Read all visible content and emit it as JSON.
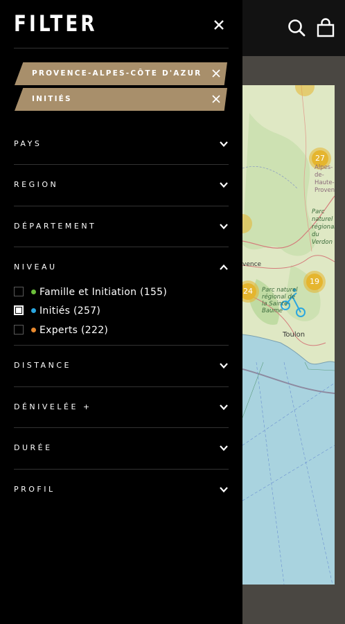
{
  "drawer": {
    "title": "FILTER",
    "active_tags": [
      {
        "label": "PROVENCE-ALPES-CÔTE D'AZUR"
      },
      {
        "label": "INITIÉS"
      }
    ],
    "sections": [
      {
        "label": "PAYS",
        "expanded": false
      },
      {
        "label": "REGION",
        "expanded": false
      },
      {
        "label": "DÉPARTEMENT",
        "expanded": false
      },
      {
        "label": "NIVEAU",
        "expanded": true
      },
      {
        "label": "DISTANCE",
        "expanded": false
      },
      {
        "label": "DÉNIVELÉE +",
        "expanded": false
      },
      {
        "label": "DURÉE",
        "expanded": false
      },
      {
        "label": "PROFIL",
        "expanded": false
      }
    ],
    "niveau_options": [
      {
        "label": "Famille et Initiation (155)",
        "checked": false,
        "dot_color": "#6bbf3a"
      },
      {
        "label": "Initiés (257)",
        "checked": true,
        "dot_color": "#2aa6e0"
      },
      {
        "label": "Experts (222)",
        "checked": false,
        "dot_color": "#e8892e"
      }
    ]
  },
  "header": {
    "icons": [
      "search-icon",
      "cart-icon"
    ]
  },
  "map": {
    "clusters": [
      "27",
      "19",
      "24"
    ],
    "labels": [
      "Toulon",
      "Parc naturel régional de la Sainte-Baume",
      "Alpes-de-Haute-Provence",
      "Parc naturel régional du Verdon",
      "vence"
    ],
    "cluster_color": "#e5b52e"
  }
}
